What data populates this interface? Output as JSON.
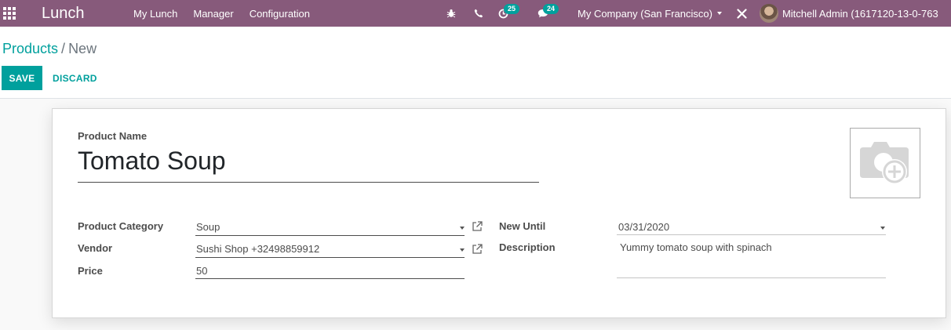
{
  "navbar": {
    "brand": "Lunch",
    "menu": [
      "My Lunch",
      "Manager",
      "Configuration"
    ],
    "activities_count": "25",
    "messages_count": "24",
    "company": "My Company (San Francisco)",
    "user": "Mitchell Admin (1617120-13-0-763"
  },
  "breadcrumb": {
    "parent": "Products",
    "separator": "/",
    "current": "New"
  },
  "buttons": {
    "save": "SAVE",
    "discard": "DISCARD"
  },
  "form": {
    "name_label": "Product Name",
    "name_value": "Tomato Soup",
    "category_label": "Product Category",
    "category_value": "Soup",
    "vendor_label": "Vendor",
    "vendor_value": "Sushi Shop +32498859912",
    "price_label": "Price",
    "price_value": "50",
    "new_until_label": "New Until",
    "new_until_value": "03/31/2020",
    "description_label": "Description",
    "description_value": "Yummy tomato soup with spinach"
  },
  "colors": {
    "navbar": "#875a7b",
    "primary": "#00a09d"
  },
  "icons": [
    "apps-grid-icon",
    "bug-icon",
    "phone-icon",
    "activity-clock-icon",
    "chat-icon",
    "tools-icon",
    "external-link-icon",
    "camera-plus-icon"
  ]
}
